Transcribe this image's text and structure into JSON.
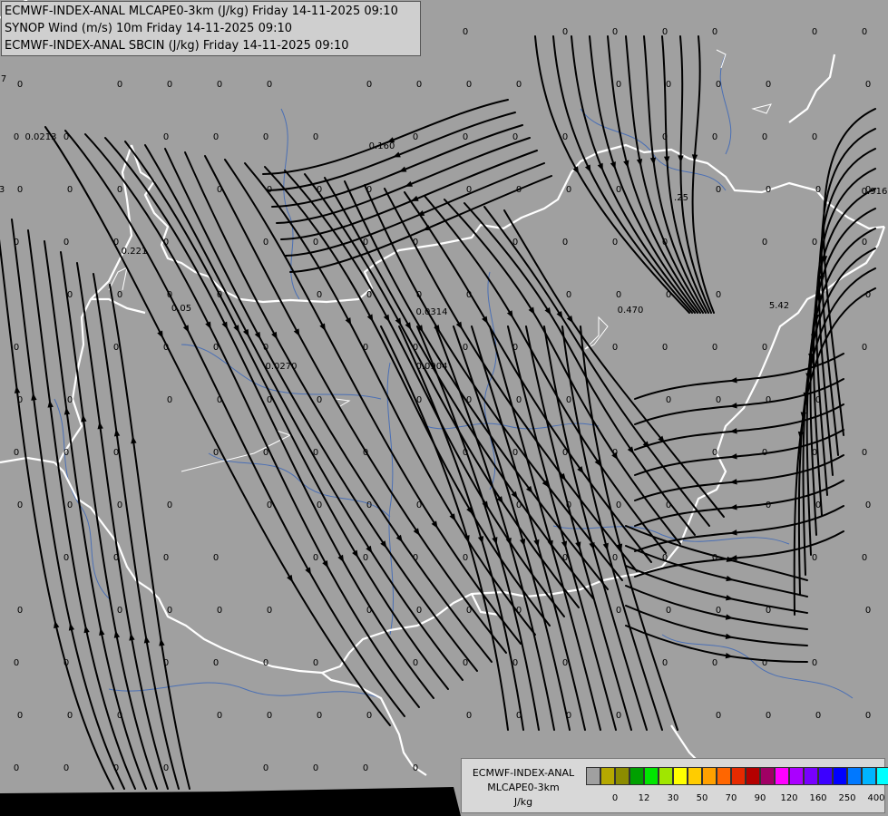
{
  "header": {
    "line1": "ECMWF-INDEX-ANAL MLCAPE0-3km (J/kg) Friday 14-11-2025 09:10",
    "line2": "SYNOP Wind (m/s) 10m Friday 14-11-2025 09:10",
    "line3": "ECMWF-INDEX-ANAL SBCIN (J/kg) Friday 14-11-2025 09:10"
  },
  "legend": {
    "line1": "ECMWF-INDEX-ANAL",
    "line2": "MLCAPE0-3km",
    "unit": "J/kg",
    "colors": [
      "#a0a0a0",
      "#b5a800",
      "#8c8c00",
      "#00a000",
      "#00e600",
      "#a0e600",
      "#ffff00",
      "#ffcc00",
      "#ffa000",
      "#ff6600",
      "#e62a00",
      "#b40000",
      "#a00064",
      "#ff00ff",
      "#aa00ff",
      "#7800ff",
      "#3c00ff",
      "#0000ff",
      "#0078ff",
      "#00b4ff",
      "#00ffff",
      "#96ffff",
      "#ffffff"
    ],
    "ticks": [
      "0",
      "12",
      "30",
      "50",
      "70",
      "90",
      "120",
      "160",
      "250",
      "400"
    ]
  },
  "field_labels": {
    "zeros": "0",
    "v1": "0.0213",
    "v2": "0.160",
    "v3": "0.221",
    "v4": "0.0314",
    "v5": "0.470",
    "v6": "0.05",
    "v7": "0.0270",
    "v8": "0.0904",
    "v9": ".25",
    "v10": "5.42",
    "v11": "0.916",
    "v12": "7",
    "v13": "3"
  },
  "colors": {
    "background": "#a0a0a0",
    "border": "#ffffff",
    "river": "#4a6fb5",
    "streamline": "#000000"
  }
}
